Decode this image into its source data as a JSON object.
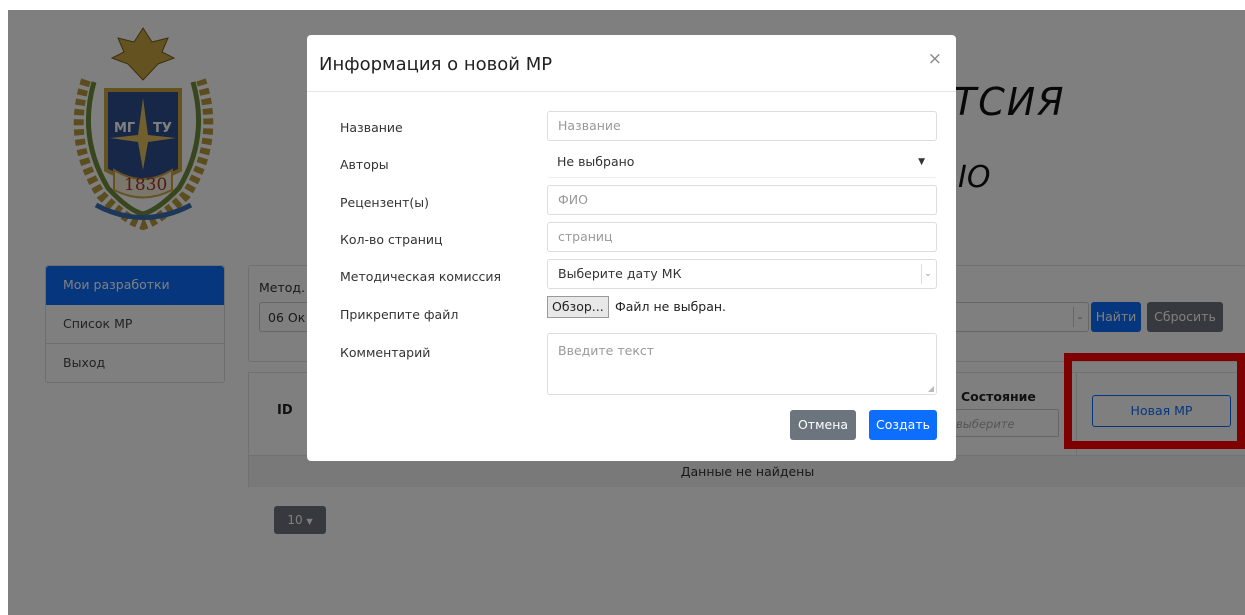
{
  "background": {
    "title_fragment": "ТСИЯ",
    "subtitle_fragment": "ІО",
    "crest_year": "1830",
    "crest_letters_left": "МГ",
    "crest_letters_right": "ТУ"
  },
  "sidebar": {
    "items": [
      {
        "label": "Мои разработки",
        "active": true
      },
      {
        "label": "Список МР",
        "active": false
      },
      {
        "label": "Выход",
        "active": false
      }
    ]
  },
  "filter": {
    "label": "Метод.",
    "select_value": "06 Ок",
    "find_label": "Найти",
    "reset_label": "Сбросить"
  },
  "table": {
    "col_id": "ID",
    "col_state": "Состояние",
    "state_placeholder": "выберите",
    "new_button_label": "Новая МР",
    "empty_message": "Данные не найдены"
  },
  "pagination": {
    "page_size": "10"
  },
  "modal": {
    "title": "Информация о новой МР",
    "close": "×",
    "fields": {
      "name": {
        "label": "Название",
        "placeholder": "Название"
      },
      "authors": {
        "label": "Авторы",
        "value": "Не выбрано"
      },
      "reviewers": {
        "label": "Рецензент(ы)",
        "placeholder": "ФИО"
      },
      "pages": {
        "label": "Кол-во страниц",
        "placeholder": "страниц"
      },
      "commission": {
        "label": "Методическая комиссия",
        "value": "Выберите дату МК"
      },
      "file": {
        "label": "Прикрепите файл",
        "button": "Обзор...",
        "status": "Файл не выбран."
      },
      "comment": {
        "label": "Комментарий",
        "placeholder": "Введите текст"
      }
    },
    "cancel_label": "Отмена",
    "create_label": "Создать"
  },
  "colors": {
    "primary": "#0d6efd",
    "secondary": "#6c757d",
    "highlight": "#ff0000"
  }
}
